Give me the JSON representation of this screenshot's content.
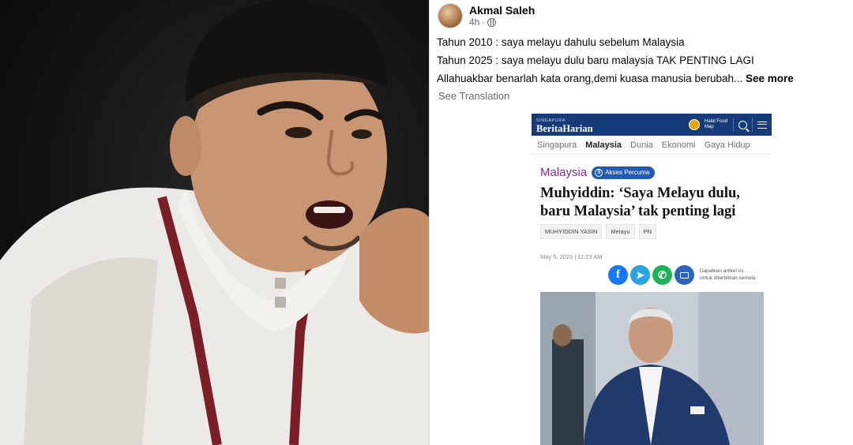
{
  "post": {
    "author_name": "Akmal Saleh",
    "time": "4h",
    "lines": [
      "Tahun 2010 : saya melayu dahulu sebelum Malaysia",
      "Tahun 2025 : saya melayu dulu baru malaysia TAK PENTING LAGI",
      "Allahuakbar benarlah kata orang,demi kuasa manusia berubah..."
    ],
    "see_more": "See more",
    "see_translation": "See Translation"
  },
  "article": {
    "brand_sub": "SINGAPURA",
    "brand_name": "BeritaHarian",
    "halal_label": "Halal Food Map",
    "nav": [
      "Singapura",
      "Malaysia",
      "Dunia",
      "Ekonomi",
      "Gaya Hidup"
    ],
    "nav_active_index": 1,
    "section": "Malaysia",
    "badge": "Akses Percuma",
    "headline_line1": "Muhyiddin: ‘Saya Melayu dulu,",
    "headline_line2": "baru Malaysia’ tak penting lagi",
    "tags": [
      "MUHYIDDIN YASIN",
      "Melayu",
      "PN"
    ],
    "date": "May 5, 2025 | 11:23 AM",
    "share_note_line1": "Dapatkan artikel ini",
    "share_note_line2": "untuk diterbitkan semula"
  },
  "colors": {
    "brand_bar": "#173a78",
    "section_purple": "#8a2c8e",
    "badge_blue": "#1f5bb5",
    "facebook": "#1877f2",
    "telegram": "#2aa3df",
    "whatsapp": "#1fb156"
  }
}
